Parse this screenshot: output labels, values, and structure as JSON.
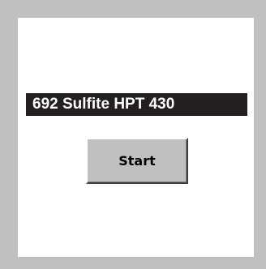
{
  "screen": {
    "title": "692 Sulfite HPT 430",
    "start_label": "Start"
  },
  "colors": {
    "frame": "#c0c0c0",
    "panel": "#ffffff",
    "title_background": "#231f20",
    "title_text": "#ffffff",
    "button_face": "#c0c0c0"
  }
}
